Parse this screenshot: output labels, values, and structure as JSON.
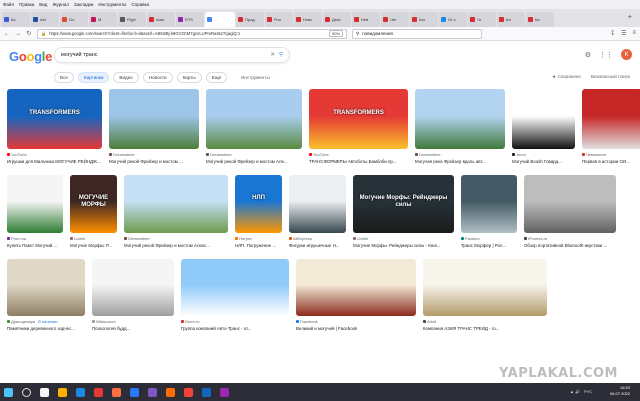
{
  "menubar": [
    "Файл",
    "Правка",
    "Вид",
    "Журнал",
    "Закладки",
    "Инструменты",
    "Справка"
  ],
  "tabs": [
    {
      "label": "Ас",
      "color": "#3b5bdb",
      "active": false
    },
    {
      "label": "Ast",
      "color": "#1c4fa1",
      "active": false
    },
    {
      "label": "Go",
      "color": "#e04b35",
      "active": false
    },
    {
      "label": "М",
      "color": "#c2185b",
      "active": false
    },
    {
      "label": "Fligh",
      "color": "#555555",
      "active": false
    },
    {
      "label": "Агас",
      "color": "#d32f2f",
      "active": false
    },
    {
      "label": "RTS",
      "color": "#8e24aa",
      "active": false
    },
    {
      "label": "",
      "color": "#4285f4",
      "active": true
    },
    {
      "label": "Прод",
      "color": "#d32f2f",
      "active": false
    },
    {
      "label": "Роо",
      "color": "#d32f2f",
      "active": false
    },
    {
      "label": "Новс",
      "color": "#d32f2f",
      "active": false
    },
    {
      "label": "Дега",
      "color": "#d32f2f",
      "active": false
    },
    {
      "label": "Нев",
      "color": "#d32f2f",
      "active": false
    },
    {
      "label": "Чет",
      "color": "#d32f2f",
      "active": false
    },
    {
      "label": "Кат",
      "color": "#d32f2f",
      "active": false
    },
    {
      "label": "Gr o",
      "color": "#1e88e5",
      "active": false
    },
    {
      "label": "Чт",
      "color": "#d32f2f",
      "active": false
    },
    {
      "label": "Ка",
      "color": "#d32f2f",
      "active": false
    },
    {
      "label": "Ка",
      "color": "#d32f2f",
      "active": false
    }
  ],
  "nav": {
    "url": "https://www.google.com/search?client=firefox-b-d&sxsrf=AB5stBj-k9GV3CM7gcnLUPmRas5LTcjagiQ:1",
    "zoom": "90%",
    "search_box": "повидомления"
  },
  "google": {
    "logo_letters": [
      {
        "ch": "G",
        "color": "#4285f4"
      },
      {
        "ch": "o",
        "color": "#ea4335"
      },
      {
        "ch": "o",
        "color": "#fbbc05"
      },
      {
        "ch": "g",
        "color": "#4285f4"
      },
      {
        "ch": "l",
        "color": "#34a853"
      },
      {
        "ch": "e",
        "color": "#ea4335"
      }
    ],
    "query": "могучий транс",
    "avatar": "К",
    "tabs": [
      "Все",
      "Картинки",
      "Видео",
      "Новости",
      "Карты",
      "Ещё"
    ],
    "active_tab": "Картинки",
    "tools": "Инструменты",
    "saved": "Сохранено",
    "safe_search": "Безопасный поиск"
  },
  "results": [
    {
      "src": "YouTube",
      "cap": "Игрушки для Мальчика МОГУЧИЕ РЕЙНДЖЕРЫ",
      "dot": "#ff0000",
      "colors": [
        "#1565c0",
        "#e53935"
      ],
      "text": "TRANSFORMERS",
      "tag": ""
    },
    {
      "src": "Dreamstime",
      "cap": "Могучий рекой Фрейзер и мостом ...",
      "dot": "#6d4c41",
      "colors": [
        "#9cc5e8",
        "#4f7d3a"
      ],
      "text": "",
      "tag": ""
    },
    {
      "src": "Dreamstime",
      "cap": "Могучий рекой Фрейзер и мостом Але...",
      "dot": "#6d4c41",
      "colors": [
        "#a9cdef",
        "#5a8a40"
      ],
      "text": "",
      "tag": ""
    },
    {
      "src": "YouTube",
      "cap": "ТРАНСФОРМЕРЫ Автоботы Бамблби пр...",
      "dot": "#ff0000",
      "colors": [
        "#e53935",
        "#fbc02d"
      ],
      "text": "TRANSFORMERS",
      "tag": ""
    },
    {
      "src": "Dreamstime",
      "cap": "Могучая река Фрейзер вдоль авт...",
      "dot": "#6d4c41",
      "colors": [
        "#b3d4f0",
        "#3f7a3a"
      ],
      "text": "",
      "tag": ""
    },
    {
      "src": "Joom",
      "cap": "Могучий Boosh Говард...",
      "dot": "#212121",
      "colors": [
        "#ffffff",
        "#111111"
      ],
      "text": "",
      "tag": ""
    },
    {
      "src": "Чемпионат",
      "cap": "Первая в истории ОИ...",
      "dot": "#d32f2f",
      "colors": [
        "#c62828",
        "#e0e0e0"
      ],
      "text": "",
      "tag": ""
    },
    {
      "src": "Prom.ua",
      "cap": "Купить Пакет Могучий ...",
      "dot": "#7b1fa2",
      "colors": [
        "#f5f5f5",
        "#2e7d32"
      ],
      "text": "",
      "tag": ""
    },
    {
      "src": "Livelib",
      "cap": "Могучие Морфы: Р...",
      "dot": "#8d6e63",
      "colors": [
        "#3e2723",
        "#ff8f00"
      ],
      "text": "МОГУЧИЕ МОРФЫ",
      "tag": ""
    },
    {
      "src": "Dreamstime",
      "cap": "Могучий рекой Фрейзер и мостом Алекс...",
      "dot": "#6d4c41",
      "colors": [
        "#c5dff4",
        "#6d9b4e"
      ],
      "text": "",
      "tag": ""
    },
    {
      "src": "Литрес",
      "cap": "НЛП. Погружение ...",
      "dot": "#ff6f00",
      "colors": [
        "#1976d2",
        "#ff9800"
      ],
      "text": "НЛП",
      "tag": ""
    },
    {
      "src": "AliExpress",
      "cap": "Фигурки игрушечные Н...",
      "dot": "#e65100",
      "colors": [
        "#eceff1",
        "#37474f"
      ],
      "text": "",
      "tag": ""
    },
    {
      "src": "Livelib",
      "cap": "Могучие Морфы. Рейнджеры силы - Книг...",
      "dot": "#8d6e63",
      "colors": [
        "#263238",
        "#1b1b1b"
      ],
      "text": "Могучие Морфы: Рейнджеры силы",
      "tag": ""
    },
    {
      "src": "Fandom",
      "cap": "Транс Морфер | Рол...",
      "dot": "#00897b",
      "colors": [
        "#455a64",
        "#b0bec5"
      ],
      "text": "",
      "tag": ""
    },
    {
      "src": "iPhones.ru",
      "cap": "Обзор портативной Bluetooth-акустики ...",
      "dot": "#424242",
      "colors": [
        "#bdbdbd",
        "#616161"
      ],
      "text": "",
      "tag": ""
    },
    {
      "src": "Драгоценара",
      "cap": "Памятники деревянного зодчес...",
      "dot": "#388e3c",
      "colors": [
        "#e0d9c8",
        "#8d7d62"
      ],
      "text": "",
      "tag": "В наличии"
    },
    {
      "src": "Wikisource",
      "cap": "Психология будд...",
      "dot": "#9e9e9e",
      "colors": [
        "#f5f5f5",
        "#9e9e9e"
      ],
      "text": "",
      "tag": ""
    },
    {
      "src": "Drom.ru",
      "cap": "Группа компаний Авто-Транс - от...",
      "dot": "#d32f2f",
      "colors": [
        "#90caf9",
        "#ffffff"
      ],
      "text": "",
      "tag": ""
    },
    {
      "src": "Facebook",
      "cap": "Великий и могучий | Facebook",
      "dot": "#1877f2",
      "colors": [
        "#f3ead7",
        "#8b2b1d"
      ],
      "text": "",
      "tag": ""
    },
    {
      "src": "Artoll",
      "cap": "Компания АЗИЯ ТРАНС ТРЕЙД - го...",
      "dot": "#5d4037",
      "colors": [
        "#f7f4ec",
        "#b39b6b"
      ],
      "text": "",
      "tag": ""
    }
  ],
  "taskbar": {
    "time": "16:53",
    "date": "06.07.2022",
    "lang": "РУС",
    "icons": [
      "#3a7bd5",
      "#f5f5f5",
      "#ffb300",
      "#1e88e5",
      "#e53935",
      "#ff7043",
      "#2979ff",
      "#7e57c2",
      "#ff6d00",
      "#f44336",
      "#1565c0",
      "#9c27b0"
    ]
  },
  "watermark": "YAPLAKAL.COM"
}
